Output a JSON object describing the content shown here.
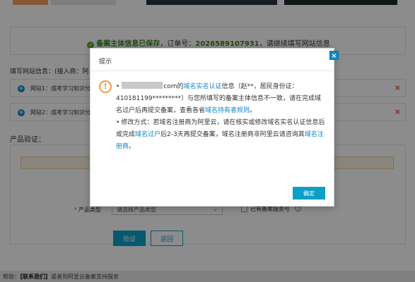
{
  "page": {
    "saved_notice": {
      "strong": "备案主体信息已保存",
      "order_prefix": "，订单号：",
      "order_no": "2026589107931",
      "suffix": "，请继续填写网站信息"
    },
    "website_info_label": "填写网站信息：(接入商：阿",
    "sites": [
      {
        "label": "网站1：成考学习知识分"
      },
      {
        "label": "网站2：成考学习知识分"
      }
    ],
    "product_verify": {
      "title": "产品验证：",
      "product_type_label": "产品类型",
      "product_type_placeholder": "请选择产品类型",
      "filed_checkbox_label": "已有备案服务号",
      "verify_button": "验证",
      "back_button": "返回"
    },
    "footer": {
      "prefix": "帮助：",
      "link_text": "【联系我们】",
      "rest": "或者到阿里云备案支持服务"
    }
  },
  "modal": {
    "title": "提示",
    "close_label": "×",
    "alert_symbol": "!",
    "para1": {
      "bullet": "•",
      "domain_suffix": "com的",
      "link1": "域名实名认证",
      "text1": "信息（赵**，居民身份证：410181199*********）与您所填写的备案主体信息不一致，请在完成域名过户后再提交备案，查看各省",
      "link2": "域名持有者规则",
      "text2": "。"
    },
    "para2": {
      "bullet": "•",
      "text1": "修改方式：若域名注册商为阿里云，请在核实或修改域名实名认证信息后或完成",
      "link1": "域名过户",
      "text2": "后2-3天再提交备案，域名注册商非阿里云请咨询其",
      "link2": "域名注册商",
      "text3": "。"
    },
    "confirm_button": "确定"
  },
  "colors": {
    "accent": "#0d87c8",
    "button": "#0aa0c8",
    "warning": "#f09a3a",
    "success": "#3a8a1e",
    "danger": "#e84a3c"
  },
  "icons": [
    "check-circle-icon",
    "plus-circle-icon",
    "close-icon",
    "warning-icon",
    "help-icon",
    "chevron-down-icon"
  ]
}
